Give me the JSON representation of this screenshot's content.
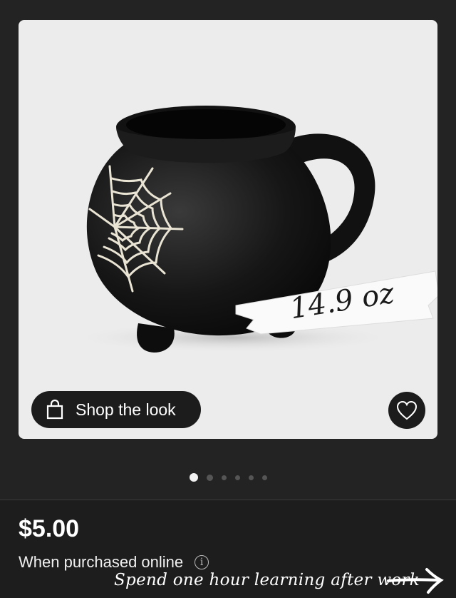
{
  "product": {
    "capacity_label": "14.9 oz",
    "shop_button_label": "Shop the look",
    "price": "$5.00",
    "purchase_note": "When purchased online",
    "info_icon_symbol": "i"
  },
  "carousel": {
    "total_images": 6,
    "active_index": 0
  },
  "caption": {
    "text": "Spend one hour learning after work"
  },
  "icons": {
    "shop": "shopping-bag-icon",
    "favorite": "heart-outline-icon",
    "info": "info-circle-icon",
    "caption_arrow": "right-arrow-icon"
  },
  "colors": {
    "background": "#232323",
    "card": "#ececec",
    "button": "#1c1c1c",
    "text": "#ffffff"
  }
}
